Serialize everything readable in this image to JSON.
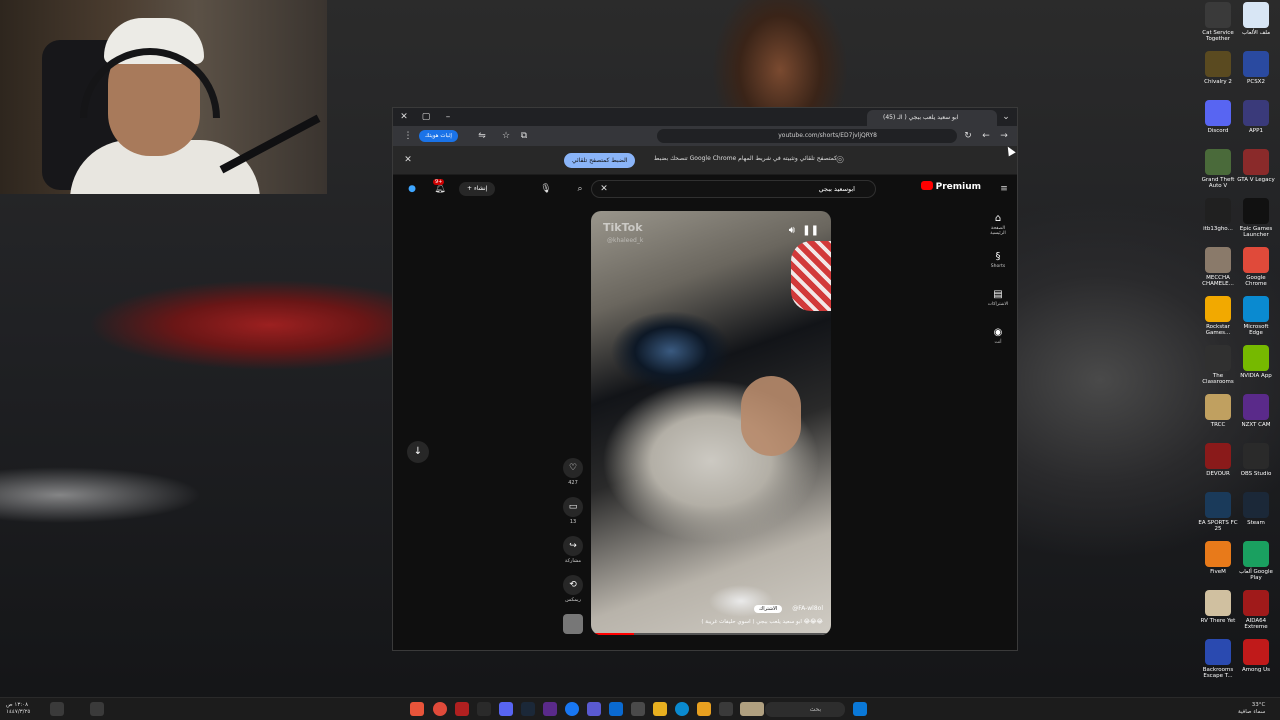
{
  "browser": {
    "tab_title": "(45) ابو سعيد يلعب ببجي ( الـ",
    "url": "youtube.com/shorts/ED7jvljQRY8",
    "profile_label": "إثبات هويتك",
    "infobar_text": "تنصحك بضبط Google Chrome كمتصفح تلقائي وتثبيته في شريط المهام",
    "infobar_button": "الضبط كمتصفح تلقائي"
  },
  "youtube": {
    "search_query": "ابوسعيد ببجي",
    "premium_label": "Premium",
    "create_label": "إنشاء",
    "notif_count": "9+",
    "sidebar": [
      {
        "icon": "home-icon",
        "glyph": "⌂",
        "label": "الصفحة الرئيسية"
      },
      {
        "icon": "shorts-icon",
        "glyph": "§",
        "label": "Shorts"
      },
      {
        "icon": "subscriptions-icon",
        "glyph": "▤",
        "label": "الاشتراكات"
      },
      {
        "icon": "you-icon",
        "glyph": "◉",
        "label": "أنت"
      }
    ],
    "short": {
      "watermark": "TikTok",
      "watermark_handle": "@khaleed_k",
      "channel": "@FA-wl8ol",
      "subscribe": "الاشتراك",
      "caption": "ابو سعيد يلعب ببجي ( اسوي حليفات غريبة ) 😂😂😂"
    },
    "actions": {
      "likes": "427",
      "comments": "13",
      "share": "مشاركة",
      "remix": "ريمكس"
    }
  },
  "desktop_icons": [
    {
      "icon": "counter-strike-icon",
      "label": "Cat Service Together",
      "color": "#3a3a3a"
    },
    {
      "icon": "file-icon",
      "label": "ملف الألعاب",
      "color": "#d8e6f5"
    },
    {
      "icon": "chivalry-icon",
      "label": "Chivalry 2",
      "color": "#5a4a20"
    },
    {
      "icon": "pcsx2-icon",
      "label": "PCSX2",
      "color": "#2a4aa0"
    },
    {
      "icon": "discord-icon",
      "label": "Discord",
      "color": "#5865f2"
    },
    {
      "icon": "app-icon",
      "label": "APP1",
      "color": "#3a3a7a"
    },
    {
      "icon": "gta-icon",
      "label": "Grand Theft Auto V",
      "color": "#4a6a3a"
    },
    {
      "icon": "gta5-legacy-icon",
      "label": "GTA V Legacy",
      "color": "#8a2a2a"
    },
    {
      "icon": "game-icon",
      "label": "itb13gho...",
      "color": "#202020"
    },
    {
      "icon": "epic-icon",
      "label": "Epic Games Launcher",
      "color": "#111111"
    },
    {
      "icon": "game2-icon",
      "label": "MECCHA CHAMELE...",
      "color": "#8a7a6a"
    },
    {
      "icon": "chrome-icon",
      "label": "Google Chrome",
      "color": "#e04a3a"
    },
    {
      "icon": "rockstar-icon",
      "label": "Rockstar Games...",
      "color": "#f2a900"
    },
    {
      "icon": "edge-icon",
      "label": "Microsoft Edge",
      "color": "#0a8ad0"
    },
    {
      "icon": "classrooms-icon",
      "label": "The Classrooms",
      "color": "#303030"
    },
    {
      "icon": "nvidia-icon",
      "label": "NVIDIA App",
      "color": "#76b900"
    },
    {
      "icon": "trcc-icon",
      "label": "TRCC",
      "color": "#c0a060"
    },
    {
      "icon": "nzxt-icon",
      "label": "NZXT CAM",
      "color": "#5a2a8a"
    },
    {
      "icon": "devour-icon",
      "label": "DEVOUR",
      "color": "#8a1a1a"
    },
    {
      "icon": "obs-icon",
      "label": "OBS Studio",
      "color": "#2a2a2a"
    },
    {
      "icon": "fc25-icon",
      "label": "EA SPORTS FC 25",
      "color": "#1a3a5a"
    },
    {
      "icon": "steam-icon",
      "label": "Steam",
      "color": "#1b2838"
    },
    {
      "icon": "fivem-icon",
      "label": "FiveM",
      "color": "#e87a1a"
    },
    {
      "icon": "play-icon",
      "label": "ألعاب Google Play",
      "color": "#1aa060"
    },
    {
      "icon": "rv-icon",
      "label": "RV There Yet",
      "color": "#d0c0a0"
    },
    {
      "icon": "aida-icon",
      "label": "AIDA64 Extreme",
      "color": "#a01a1a"
    },
    {
      "icon": "backrooms-icon",
      "label": "Backrooms Escape T...",
      "color": "#2a4ab0"
    },
    {
      "icon": "amongus-icon",
      "label": "Among Us",
      "color": "#c01a1a"
    }
  ],
  "taskbar": {
    "time": "١٣:٠٨ ص",
    "date": "١٤٤٧/٣/٢٥",
    "search_placeholder": "بحث",
    "weather_temp": "33°C",
    "weather_desc": "سماء صافية"
  }
}
